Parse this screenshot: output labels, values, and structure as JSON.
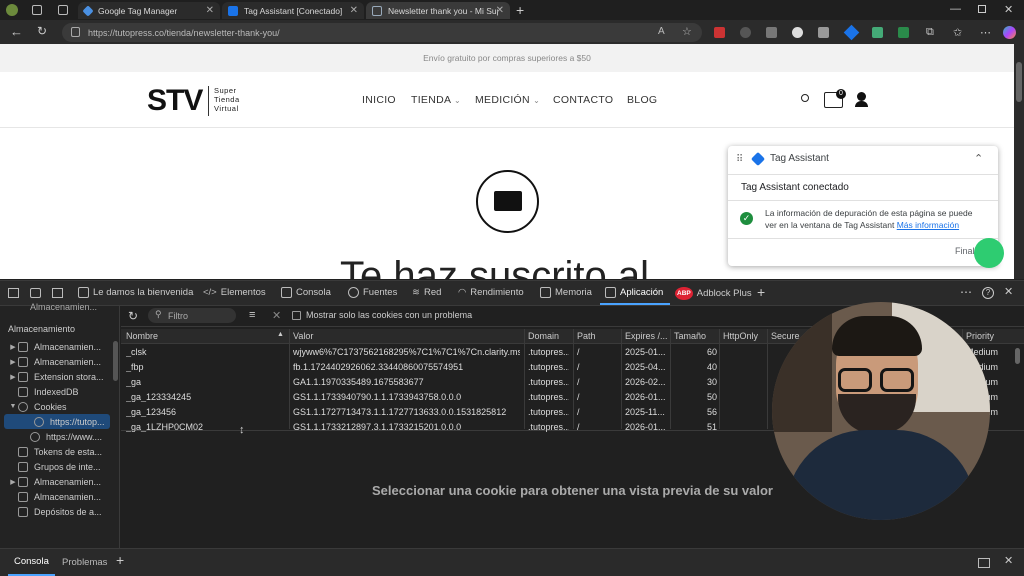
{
  "browser": {
    "tabs": [
      {
        "title": "Google Tag Manager"
      },
      {
        "title": "Tag Assistant [Conectado]"
      },
      {
        "title": "Newsletter thank you - Mi Super"
      }
    ],
    "url": "https://tutopress.co/tienda/newsletter-thank-you/"
  },
  "site": {
    "promo": "Envío gratuito por compras superiores a $50",
    "logo_text": "STV",
    "logo_sub": [
      "Super",
      "Tienda",
      "Virtual"
    ],
    "nav": [
      "INICIO",
      "TIENDA",
      "MEDICIÓN",
      "CONTACTO",
      "BLOG"
    ],
    "cart_count": "0",
    "heading": "Te haz suscrito al"
  },
  "tag_assistant": {
    "title": "Tag Assistant",
    "status": "Tag Assistant conectado",
    "message": "La información de depuración de esta página se puede ver en la ventana de Tag Assistant",
    "link": "Más información",
    "finish": "Finalizar"
  },
  "devtools": {
    "tabs": [
      "Le damos la bienvenida",
      "Elementos",
      "Consola",
      "Fuentes",
      "Red",
      "Rendimiento",
      "Memoria",
      "Aplicación",
      "Adblock Plus"
    ],
    "adblock_badge": "ABP",
    "sidebar_top": "Almacenamien...",
    "section": "Almacenamiento",
    "sidebar": [
      {
        "label": "Almacenamien...",
        "indent": 1,
        "arrow": "▶"
      },
      {
        "label": "Almacenamien...",
        "indent": 1,
        "arrow": "▶"
      },
      {
        "label": "Extension stora...",
        "indent": 1,
        "arrow": "▶"
      },
      {
        "label": "IndexedDB",
        "indent": 1,
        "arrow": ""
      },
      {
        "label": "Cookies",
        "indent": 1,
        "arrow": "▼"
      },
      {
        "label": "https://tutop...",
        "indent": 2,
        "arrow": ""
      },
      {
        "label": "https://www....",
        "indent": 2,
        "arrow": ""
      },
      {
        "label": "Tokens de esta...",
        "indent": 1,
        "arrow": ""
      },
      {
        "label": "Grupos de inte...",
        "indent": 1,
        "arrow": ""
      },
      {
        "label": "Almacenamien...",
        "indent": 1,
        "arrow": "▶"
      },
      {
        "label": "Almacenamien...",
        "indent": 1,
        "arrow": ""
      },
      {
        "label": "Depósitos de a...",
        "indent": 1,
        "arrow": ""
      }
    ],
    "filter_placeholder": "Filtro",
    "only_issues_label": "Mostrar solo las cookies con un problema",
    "columns": [
      "Nombre",
      "Valor",
      "Domain",
      "Path",
      "Expires /...",
      "Tamaño",
      "HttpOnly",
      "Secure",
      "Priority"
    ],
    "rows": [
      [
        "_clsk",
        "wjyww6%7C1737562168295%7C1%7C1%7Cn.clarity.ms...",
        ".tutopres...",
        "/",
        "2025-01...",
        "60",
        "Medium"
      ],
      [
        "_fbp",
        "fb.1.1724402926062.33440860075574951",
        ".tutopres...",
        "/",
        "2025-04...",
        "40",
        "Medium"
      ],
      [
        "_ga",
        "GA1.1.1970335489.1675583677",
        ".tutopres...",
        "/",
        "2026-02...",
        "30",
        "Medium"
      ],
      [
        "_ga_123334245",
        "GS1.1.1733940790.1.1.1733943758.0.0.0",
        ".tutopres...",
        "/",
        "2026-01...",
        "50",
        "Medium"
      ],
      [
        "_ga_123456",
        "GS1.1.1727713473.1.1.1727713633.0.0.1531825812",
        ".tutopres...",
        "/",
        "2025-11...",
        "56",
        "Medium"
      ],
      [
        "_ga_1LZHP0CM02",
        "GS1.1.1733212897.3.1.1733215201.0.0.0",
        ".tutopres...",
        "/",
        "2026-01...",
        "51",
        ""
      ]
    ],
    "preview_text": "Seleccionar una cookie para obtener una vista previa de su valor",
    "bottom_tabs": [
      "Consola",
      "Problemas"
    ]
  },
  "colors": {
    "accent": "#4aa3ff",
    "tagassist_blue": "#1a73e8",
    "green": "#34a853"
  }
}
